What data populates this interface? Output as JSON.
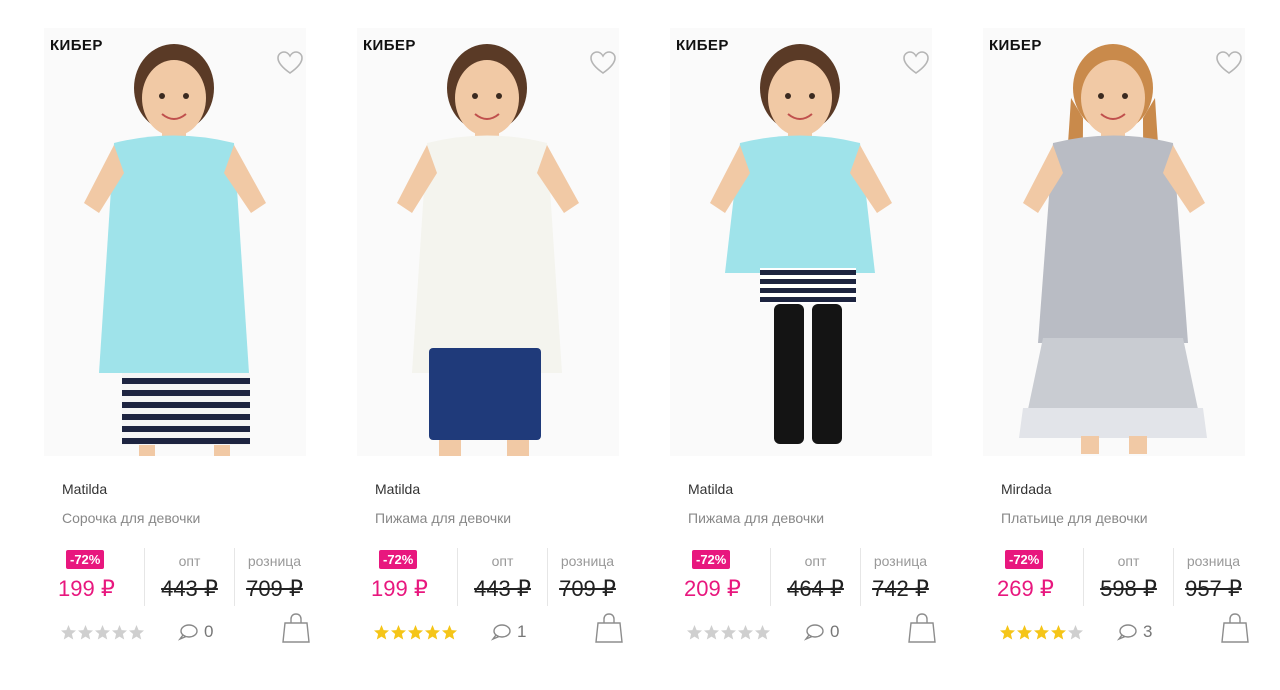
{
  "colors": {
    "accent": "#e8177e",
    "star_on": "#f5c518",
    "star_off": "#cfcfcf"
  },
  "price_labels": {
    "opt": "опт",
    "retail": "розница"
  },
  "products": [
    {
      "badge": "КИБЕР",
      "brand": "Matilda",
      "title": "Сорочка для девочки",
      "discount": "-72%",
      "price": "199 ₽",
      "opt_price": "443 ₽",
      "retail_price": "709 ₽",
      "rating": 0,
      "comments": "0",
      "top_color": "#9fe3ea",
      "bottom": "stripes"
    },
    {
      "badge": "КИБЕР",
      "brand": "Matilda",
      "title": "Пижама для девочки",
      "discount": "-72%",
      "price": "199 ₽",
      "opt_price": "443 ₽",
      "retail_price": "709 ₽",
      "rating": 5,
      "comments": "1",
      "top_color": "#f4f4ee",
      "bottom": "navy"
    },
    {
      "badge": "КИБЕР",
      "brand": "Matilda",
      "title": "Пижама для девочки",
      "discount": "-72%",
      "price": "209 ₽",
      "opt_price": "464 ₽",
      "retail_price": "742 ₽",
      "rating": 0,
      "comments": "0",
      "top_color": "#9fe3ea",
      "bottom": "black"
    },
    {
      "badge": "КИБЕР",
      "brand": "Mirdada",
      "title": "Платьице для девочки",
      "discount": "-72%",
      "price": "269 ₽",
      "opt_price": "598 ₽",
      "retail_price": "957 ₽",
      "rating": 4,
      "comments": "3",
      "top_color": "#b9bcc4",
      "bottom": "dress"
    }
  ]
}
